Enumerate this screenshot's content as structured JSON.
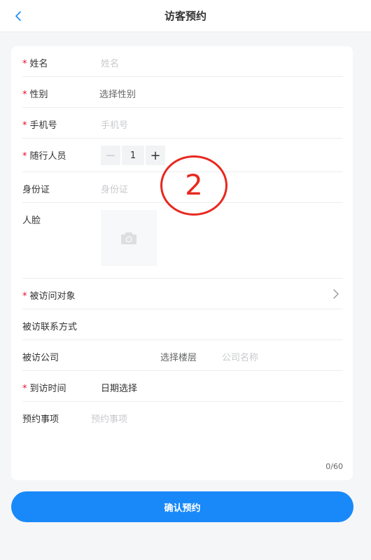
{
  "header": {
    "title": "访客预约",
    "back_icon": "chevron-left-icon"
  },
  "form": {
    "required_mark": "*",
    "name": {
      "label": "姓名",
      "placeholder": "姓名",
      "required": true
    },
    "gender": {
      "label": "性别",
      "value": "选择性别",
      "required": true
    },
    "phone": {
      "label": "手机号",
      "placeholder": "手机号",
      "required": true
    },
    "companions": {
      "label": "随行人员",
      "value": "1",
      "minus": "−",
      "plus": "+",
      "required": true
    },
    "id_card": {
      "label": "身份证",
      "placeholder": "身份证",
      "required": false
    },
    "face": {
      "label": "人脸",
      "upload_icon": "camera-icon",
      "required": false
    },
    "visit_target": {
      "label": "被访问对象",
      "required": true,
      "arrow_icon": "chevron-right-icon"
    },
    "visit_contact": {
      "label": "被访联系方式",
      "required": false
    },
    "visit_company": {
      "label": "被访公司",
      "floor_value": "选择楼层",
      "company_placeholder": "公司名称",
      "required": false
    },
    "visit_time": {
      "label": "到访时间",
      "value": "日期选择",
      "required": true
    },
    "appointment_matter": {
      "label": "预约事项",
      "placeholder": "预约事项",
      "counter": "0/60",
      "required": false
    }
  },
  "annotation": {
    "text": "2",
    "color": "#e8281f"
  },
  "submit": {
    "label": "确认预约",
    "color": "#1989fa"
  }
}
